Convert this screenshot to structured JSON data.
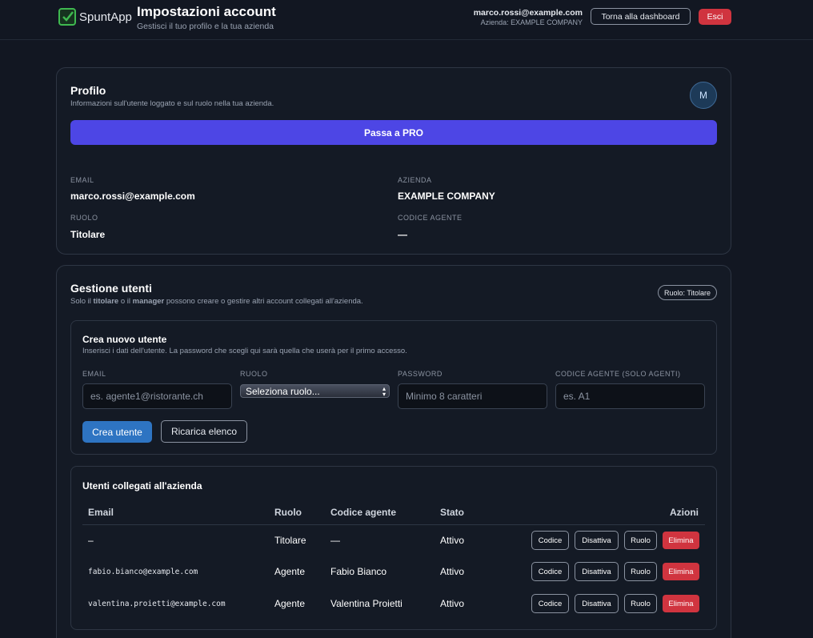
{
  "header": {
    "logo_text": "SpuntApp",
    "title": "Impostazioni account",
    "subtitle": "Gestisci il tuo profilo e la tua azienda",
    "user_email": "marco.rossi@example.com",
    "company_line": "Azienda: EXAMPLE COMPANY",
    "dashboard_button": "Torna alla dashboard",
    "logout_button": "Esci"
  },
  "profile": {
    "title": "Profilo",
    "subtitle": "Informazioni sull'utente loggato e sul ruolo nella tua azienda.",
    "avatar_initial": "M",
    "pro_button": "Passa a PRO",
    "email_label": "EMAIL",
    "email_value": "marco.rossi@example.com",
    "company_label": "AZIENDA",
    "company_value": "EXAMPLE COMPANY",
    "role_label": "RUOLO",
    "role_value": "Titolare",
    "agent_code_label": "CODICE AGENTE",
    "agent_code_value": "—"
  },
  "users": {
    "title": "Gestione utenti",
    "subtitle_pre": "Solo il ",
    "subtitle_b1": "titolare",
    "subtitle_mid": " o il ",
    "subtitle_b2": "manager",
    "subtitle_post": " possono creare o gestire altri account collegati all'azienda.",
    "role_badge": "Ruolo: Titolare",
    "create": {
      "title": "Crea nuovo utente",
      "subtitle": "Inserisci i dati dell'utente. La password che scegli qui sarà quella che userà per il primo accesso.",
      "email_label": "EMAIL",
      "email_placeholder": "es. agente1@ristorante.ch",
      "role_label": "RUOLO",
      "role_selected": "Seleziona ruolo...",
      "password_label": "PASSWORD",
      "password_placeholder": "Minimo 8 caratteri",
      "code_label": "CODICE AGENTE (SOLO AGENTI)",
      "code_placeholder": "es. A1",
      "create_button": "Crea utente",
      "reload_button": "Ricarica elenco"
    },
    "list": {
      "title": "Utenti collegati all'azienda",
      "columns": [
        "Email",
        "Ruolo",
        "Codice agente",
        "Stato",
        "Azioni"
      ],
      "rows": [
        {
          "email": "–",
          "role": "Titolare",
          "code": "—",
          "status": "Attivo"
        },
        {
          "email": "fabio.bianco@example.com",
          "role": "Agente",
          "code": "Fabio Bianco",
          "status": "Attivo"
        },
        {
          "email": "valentina.proietti@example.com",
          "role": "Agente",
          "code": "Valentina Proietti",
          "status": "Attivo"
        }
      ],
      "actions": {
        "code": "Codice",
        "deactivate": "Disattiva",
        "role": "Ruolo",
        "delete": "Elimina"
      }
    }
  },
  "colors": {
    "background": "#121722",
    "accent_purple": "#4d46e5",
    "accent_blue": "#2e74c2",
    "danger_red": "#d0343f",
    "logo_green": "#3fb950"
  }
}
